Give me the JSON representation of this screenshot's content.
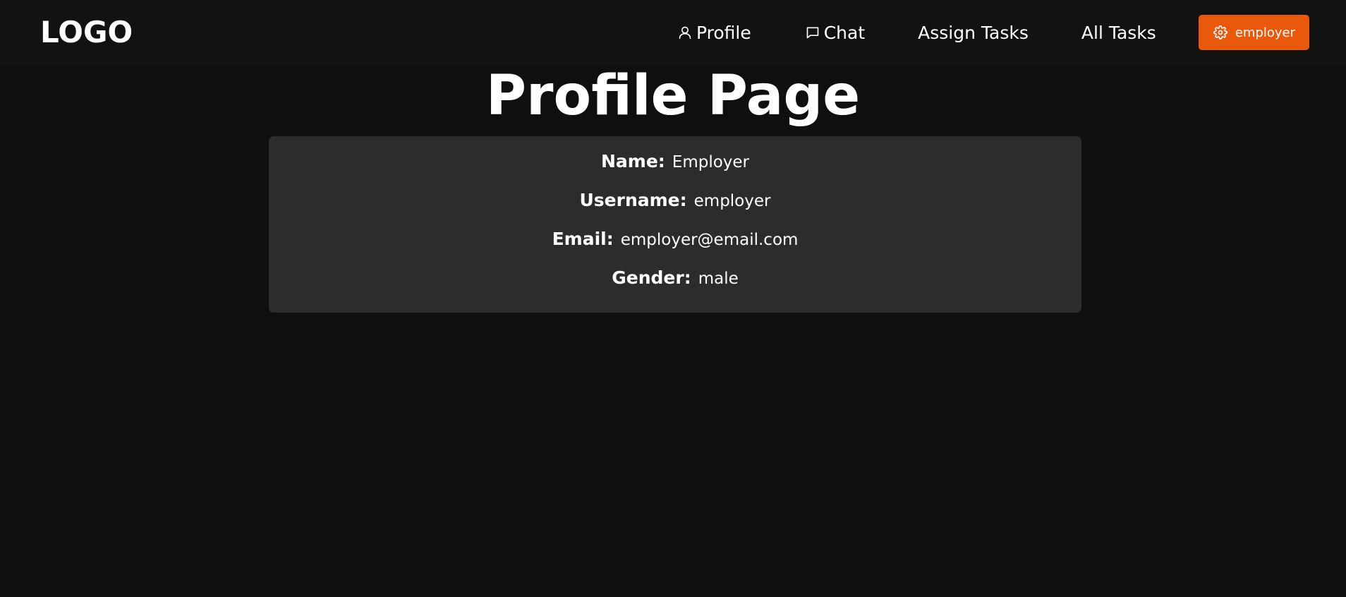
{
  "header": {
    "logo": "LOGO",
    "nav": {
      "profile": {
        "label": "Profile",
        "icon": "user-icon"
      },
      "chat": {
        "label": "Chat",
        "icon": "chat-icon"
      },
      "assign_tasks": {
        "label": "Assign Tasks"
      },
      "all_tasks": {
        "label": "All Tasks"
      }
    },
    "user_button": {
      "label": "employer",
      "icon": "gear-icon",
      "color": "#ea580c"
    }
  },
  "main": {
    "title": "Profile Page",
    "profile": {
      "name": {
        "label": "Name:",
        "value": "Employer"
      },
      "username": {
        "label": "Username:",
        "value": "employer"
      },
      "email": {
        "label": "Email:",
        "value": "employer@email.com"
      },
      "gender": {
        "label": "Gender:",
        "value": "male"
      }
    }
  },
  "colors": {
    "background": "#0e0f11",
    "navbar": "#121212",
    "card": "#2c2d2a",
    "accent": "#ea580c"
  }
}
